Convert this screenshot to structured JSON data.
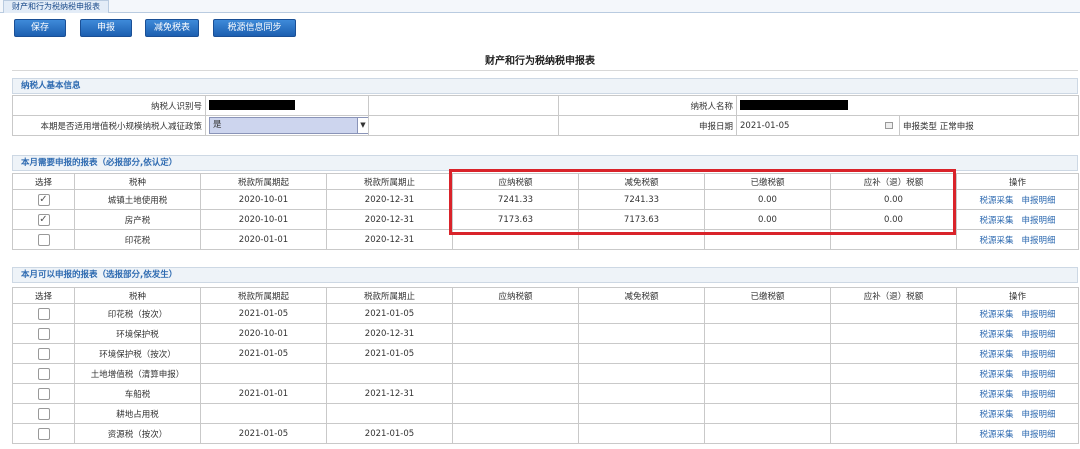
{
  "tab": {
    "label": "财产和行为税纳税申报表"
  },
  "toolbar": {
    "save": "保存",
    "declare": "申报",
    "reduce": "减免税表",
    "sync": "税源信息同步"
  },
  "page_title": "财产和行为税纳税申报表",
  "basic": {
    "heading": "纳税人基本信息",
    "taxpayer_id_label": "纳税人识别号",
    "taxpayer_name_label": "纳税人名称",
    "policy_label": "本期是否适用增值税小规模纳税人减征政策",
    "policy_value": "是",
    "date_label": "申报日期",
    "date_value": "2021-01-05",
    "type_label": "申报类型",
    "type_value": "正常申报"
  },
  "headers": [
    "选择",
    "税种",
    "税款所属期起",
    "税款所属期止",
    "应纳税额",
    "减免税额",
    "已缴税额",
    "应补（退）税额",
    "操作"
  ],
  "actions": {
    "collect": "税源采集",
    "detail": "申报明细"
  },
  "required": {
    "heading": "本月需要申报的报表（必报部分,依认定）",
    "rows": [
      {
        "checked": "✓",
        "tax": "城镇土地使用税",
        "start": "2020-10-01",
        "end": "2020-12-31",
        "due": "7241.33",
        "relief": "7241.33",
        "paid": "0.00",
        "payable": "0.00"
      },
      {
        "checked": "✓",
        "tax": "房产税",
        "start": "2020-10-01",
        "end": "2020-12-31",
        "due": "7173.63",
        "relief": "7173.63",
        "paid": "0.00",
        "payable": "0.00"
      },
      {
        "checked": "",
        "tax": "印花税",
        "start": "2020-01-01",
        "end": "2020-12-31",
        "due": "",
        "relief": "",
        "paid": "",
        "payable": ""
      }
    ]
  },
  "optional": {
    "heading": "本月可以申报的报表（选报部分,依发生）",
    "rows": [
      {
        "tax": "印花税（按次）",
        "start": "2021-01-05",
        "end": "2021-01-05"
      },
      {
        "tax": "环境保护税",
        "start": "2020-10-01",
        "end": "2020-12-31"
      },
      {
        "tax": "环境保护税（按次）",
        "start": "2021-01-05",
        "end": "2021-01-05"
      },
      {
        "tax": "土地增值税（清算申报）",
        "start": "",
        "end": ""
      },
      {
        "tax": "车船税",
        "start": "2021-01-01",
        "end": "2021-12-31"
      },
      {
        "tax": "耕地占用税",
        "start": "",
        "end": ""
      },
      {
        "tax": "资源税（按次）",
        "start": "2021-01-05",
        "end": "2021-01-05"
      }
    ]
  }
}
